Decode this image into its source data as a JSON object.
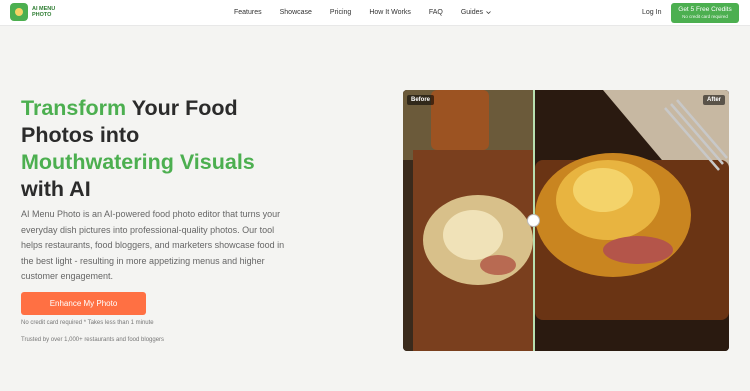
{
  "nav": {
    "logo_line1": "AI MENU",
    "logo_line2": "PHOTO",
    "links": [
      "Features",
      "Showcase",
      "Pricing",
      "How It Works",
      "FAQ",
      "Guides"
    ],
    "login": "Log In",
    "cta_title": "Get 5 Free Credits",
    "cta_sub": "No credit card required"
  },
  "hero": {
    "title_green1": "Transform",
    "title_dark1": " Your Food",
    "title_dark2": "Photos into",
    "title_green2": "Mouthwatering Visuals",
    "title_dark3": "with AI",
    "description": "AI Menu Photo is an AI-powered food photo editor that turns your everyday dish pictures into professional-quality photos. Our tool helps restaurants, food bloggers, and marketers showcase food in the best light - resulting in more appetizing menus and higher customer engagement.",
    "button": "Enhance My Photo",
    "note1": "No credit card required * Takes less than 1 minute",
    "note2": "Trusted by over 1,000+ restaurants and food bloggers"
  },
  "compare": {
    "before_label": "Before",
    "after_label": "After",
    "position_fraction": 0.4
  },
  "colors": {
    "brand_green": "#4caf50",
    "cta_orange": "#ff7043"
  }
}
